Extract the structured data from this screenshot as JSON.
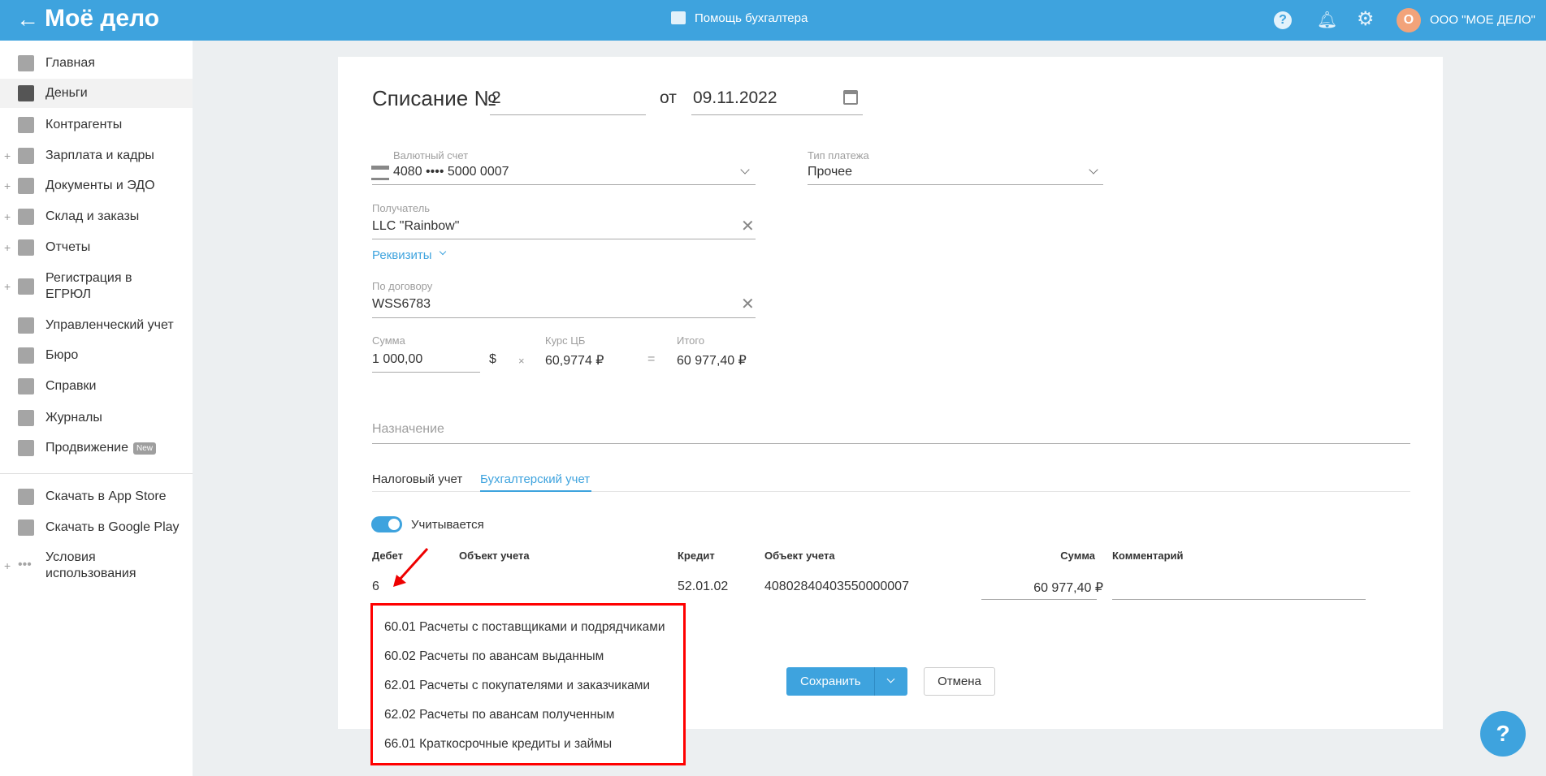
{
  "header": {
    "logo": "Моё дело",
    "help_center": "Помощь бухгалтера",
    "org_initial": "О",
    "org_name": "ООО \"МОЕ ДЕЛО\""
  },
  "sidebar": {
    "items": [
      {
        "label": "Главная",
        "plus": ""
      },
      {
        "label": "Деньги",
        "plus": ""
      },
      {
        "label": "Контрагенты",
        "plus": ""
      },
      {
        "label": "Зарплата и кадры",
        "plus": "+"
      },
      {
        "label": "Документы и ЭДО",
        "plus": "+"
      },
      {
        "label": "Склад и заказы",
        "plus": "+"
      },
      {
        "label": "Отчеты",
        "plus": "+"
      },
      {
        "label": "Регистрация в ЕГРЮЛ",
        "plus": "+"
      },
      {
        "label": "Управленческий учет",
        "plus": ""
      },
      {
        "label": "Бюро",
        "plus": ""
      },
      {
        "label": "Справки",
        "plus": ""
      },
      {
        "label": "Журналы",
        "plus": ""
      },
      {
        "label": "Продвижение",
        "plus": "",
        "badge": "New"
      }
    ],
    "bottom": [
      {
        "label": "Скачать в App Store",
        "plus": ""
      },
      {
        "label": "Скачать в Google Play",
        "plus": ""
      },
      {
        "label": "Условия использования",
        "plus": "+"
      }
    ]
  },
  "form": {
    "title": "Списание №",
    "number": "2",
    "date_prefix": "от",
    "date": "09.11.2022",
    "account_label": "Валютный счет",
    "account_value": "4080 •••• 5000 0007",
    "payment_type_label": "Тип платежа",
    "payment_type_value": "Прочее",
    "recipient_label": "Получатель",
    "recipient_value": "LLC \"Rainbow\"",
    "details_link": "Реквизиты",
    "contract_label": "По договору",
    "contract_value": "WSS6783",
    "sum_label": "Сумма",
    "sum_value": "1 000,00",
    "currency": "$",
    "times": "×",
    "rate_label": "Курс ЦБ",
    "rate_value": "60,9774 ₽",
    "equals": "=",
    "total_label": "Итого",
    "total_value": "60 977,40 ₽",
    "purpose_placeholder": "Назначение",
    "tabs": [
      "Налоговый учет",
      "Бухгалтерский учет"
    ],
    "toggle_label": "Учитывается",
    "table": {
      "headers": [
        "Дебет",
        "Объект учета",
        "Кредит",
        "Объект учета",
        "Сумма",
        "Комментарий"
      ],
      "row": {
        "debit": "6",
        "credit": "52.01.02",
        "credit_object": "40802840403550000007",
        "sum": "60 977,40 ₽"
      }
    },
    "dropdown": [
      "60.01 Расчеты с поставщиками и подрядчиками",
      "60.02 Расчеты по авансам выданным",
      "62.01 Расчеты с покупателями и заказчиками",
      "62.02 Расчеты по авансам полученным",
      "66.01 Краткосрочные кредиты и займы"
    ],
    "save": "Сохранить",
    "cancel": "Отмена"
  },
  "float_help": "?"
}
